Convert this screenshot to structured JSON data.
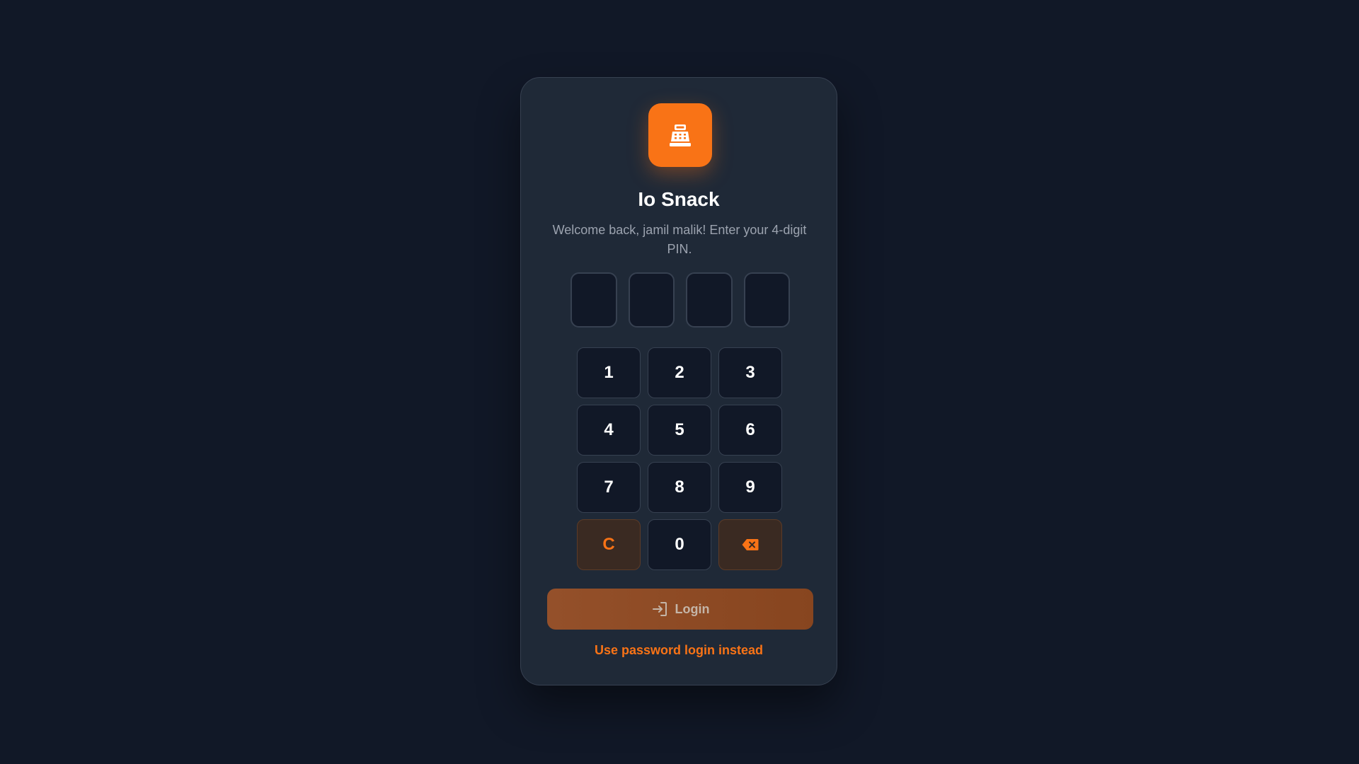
{
  "app": {
    "title": "Io Snack",
    "logo_icon": "cash-register-icon",
    "accent_color": "#f97316"
  },
  "login": {
    "welcome_text": "Welcome back, jamil malik! Enter your 4-digit PIN.",
    "pin_length": 4,
    "keys": [
      "1",
      "2",
      "3",
      "4",
      "5",
      "6",
      "7",
      "8",
      "9",
      "C",
      "0"
    ],
    "backspace_icon": "backspace-icon",
    "login_button_label": "Login",
    "login_icon": "login-arrow-icon",
    "password_login_link": "Use password login instead"
  }
}
